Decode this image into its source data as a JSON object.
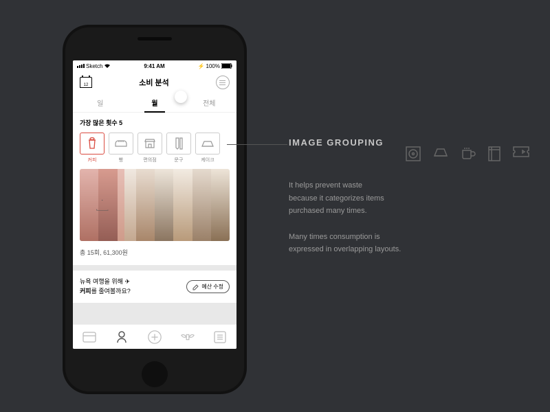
{
  "status": {
    "carrier": "Sketch",
    "time": "9:41 AM",
    "battery": "100%"
  },
  "header": {
    "cal": "12",
    "title": "소비 분석"
  },
  "tabs": [
    "일",
    "월",
    "전체"
  ],
  "active_tab": 1,
  "section_title": "가장 많은 횟수 5",
  "categories": [
    {
      "label": "커피"
    },
    {
      "label": "빵"
    },
    {
      "label": "편의점"
    },
    {
      "label": "문구"
    },
    {
      "label": "케이크"
    }
  ],
  "selected_cat": 0,
  "summary": "총 15회, 61,300원",
  "msg": {
    "line1": "뉴욕 여행을 위해",
    "bold": "커피",
    "line2": "를 줄여볼까요?"
  },
  "budget_btn": "예산 수정",
  "panel": {
    "title": "IMAGE GROUPING",
    "p1": "It helps prevent waste",
    "p2": "because it categorizes items",
    "p3": "purchased many times.",
    "p4": "Many times consumption is",
    "p5": "expressed in overlapping layouts."
  }
}
